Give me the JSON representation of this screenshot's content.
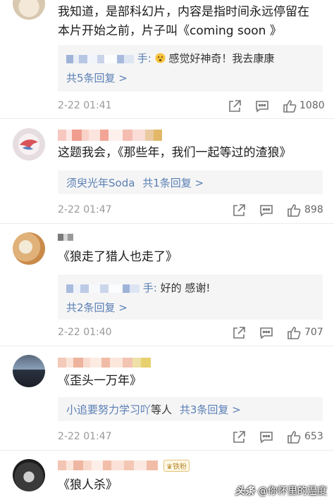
{
  "comments": [
    {
      "text": "我知道，是部科幻片，内容是指时间永远停留在本片开始之前，片子叫《coming soon 》",
      "reply_preview_suffix": "手:",
      "reply_preview_text": "感觉好神奇！我去康康",
      "reply_count_label": "共5条回复 >",
      "time": "2-22 01:41",
      "likes": "1080"
    },
    {
      "text": "这题我会，《那些年，我们一起等过的渣狼》",
      "reply_user": "须臾光年Soda",
      "reply_count_label": "共1条回复 >",
      "time": "2-22 01:47",
      "likes": "898"
    },
    {
      "text": "《狼走了猎人也走了》",
      "reply_preview_suffix": "手:",
      "reply_preview_text": "好的 感谢!",
      "reply_count_label": "共2条回复 >",
      "time": "2-22 01:40",
      "likes": "707"
    },
    {
      "text": "《歪头一万年》",
      "reply_user": "小追要努力学习吖",
      "reply_mid": "等人",
      "reply_count_label": "共3条回复 >",
      "time": "2-22 01:47",
      "likes": "653"
    },
    {
      "badge": "铁粉",
      "text": "《狼人杀》"
    }
  ],
  "watermark": {
    "logo": "头条",
    "handle": "@你怀里的温度"
  },
  "icons": {
    "share": "share-icon",
    "comment": "comment-icon",
    "like": "thumbs-up-icon",
    "emoji": "emoji-face-icon"
  },
  "colors": {
    "link": "#5a7fb5",
    "reply_bg": "#f5f5f5",
    "meta": "#999999"
  }
}
